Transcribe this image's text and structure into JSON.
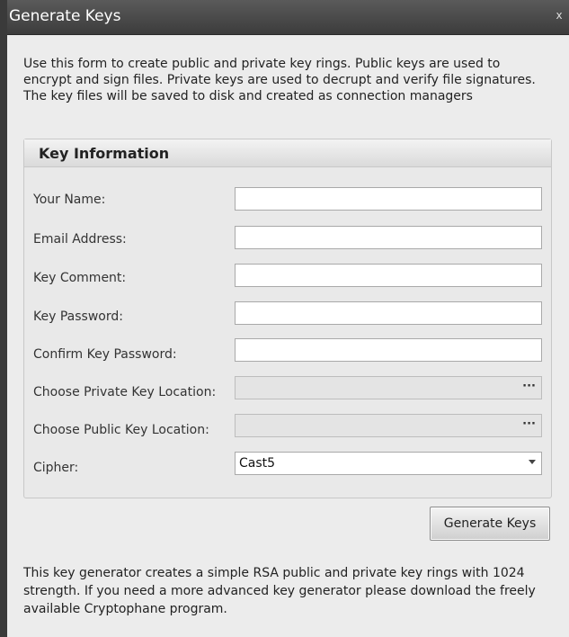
{
  "window": {
    "title": "Generate Keys",
    "close_glyph": "x"
  },
  "intro_text": "Use this form to create public and private key rings. Public keys are used to encrypt and sign files. Private keys are used to decrupt and verify file signatures. The key files will be saved to disk and created as connection managers",
  "group": {
    "title": "Key Information",
    "fields": {
      "your_name": {
        "label": "Your Name:",
        "value": ""
      },
      "email": {
        "label": "Email Address:",
        "value": ""
      },
      "key_comment": {
        "label": "Key Comment:",
        "value": ""
      },
      "key_password": {
        "label": "Key Password:",
        "value": ""
      },
      "confirm_password": {
        "label": "Confirm Key Password:",
        "value": ""
      },
      "private_location": {
        "label": "Choose Private Key Location:",
        "value": "",
        "button": "···"
      },
      "public_location": {
        "label": "Choose Public Key Location:",
        "value": "",
        "button": "···"
      },
      "cipher": {
        "label": "Cipher:",
        "value": "Cast5"
      }
    }
  },
  "generate_button": "Generate Keys",
  "footer_text": "This key generator creates a simple RSA public and private key rings with 1024 strength. If you need a more advanced key generator please download the freely available Cryptophane program."
}
